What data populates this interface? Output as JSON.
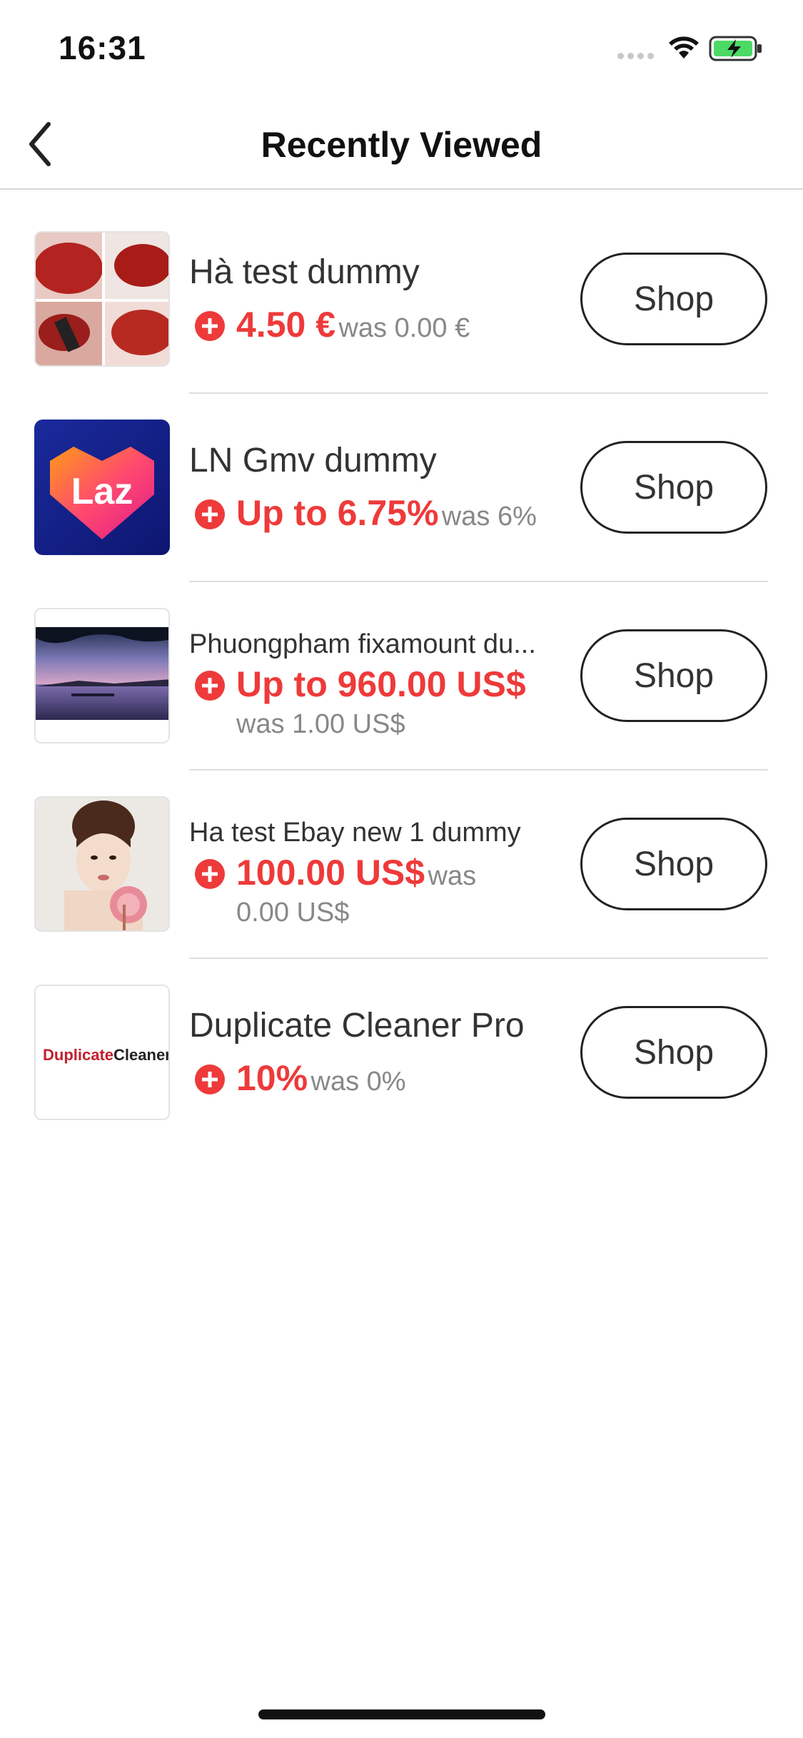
{
  "status_bar": {
    "time": "16:31"
  },
  "nav": {
    "title": "Recently Viewed"
  },
  "items": [
    {
      "title": "Hà test dummy",
      "price": "4.50 €",
      "was": "was 0.00 €",
      "button": "Shop"
    },
    {
      "title": "LN Gmv dummy",
      "price": "Up to 6.75%",
      "was": "was 6%",
      "button": "Shop",
      "logo_text": "Laz"
    },
    {
      "title": "Phuongpham fixamount du...",
      "price": "Up to 960.00 US$",
      "was": "was 1.00 US$",
      "button": "Shop"
    },
    {
      "title": "Ha test Ebay new 1 dummy",
      "price": "100.00 US$",
      "was_part1": "was",
      "was_part2": "0.00 US$",
      "button": "Shop"
    },
    {
      "title": "Duplicate Cleaner Pro",
      "price": "10%",
      "was": "was 0%",
      "button": "Shop",
      "logo_text_1": "Duplicate",
      "logo_text_2": "Cleaner"
    }
  ],
  "colors": {
    "accent_red": "#ee3a3a",
    "text_gray": "#888888",
    "divider": "#dedede"
  },
  "icons": {
    "back": "chevron-left-icon",
    "plus": "plus-circle-icon",
    "wifi": "wifi-icon",
    "battery": "battery-charging-icon"
  }
}
